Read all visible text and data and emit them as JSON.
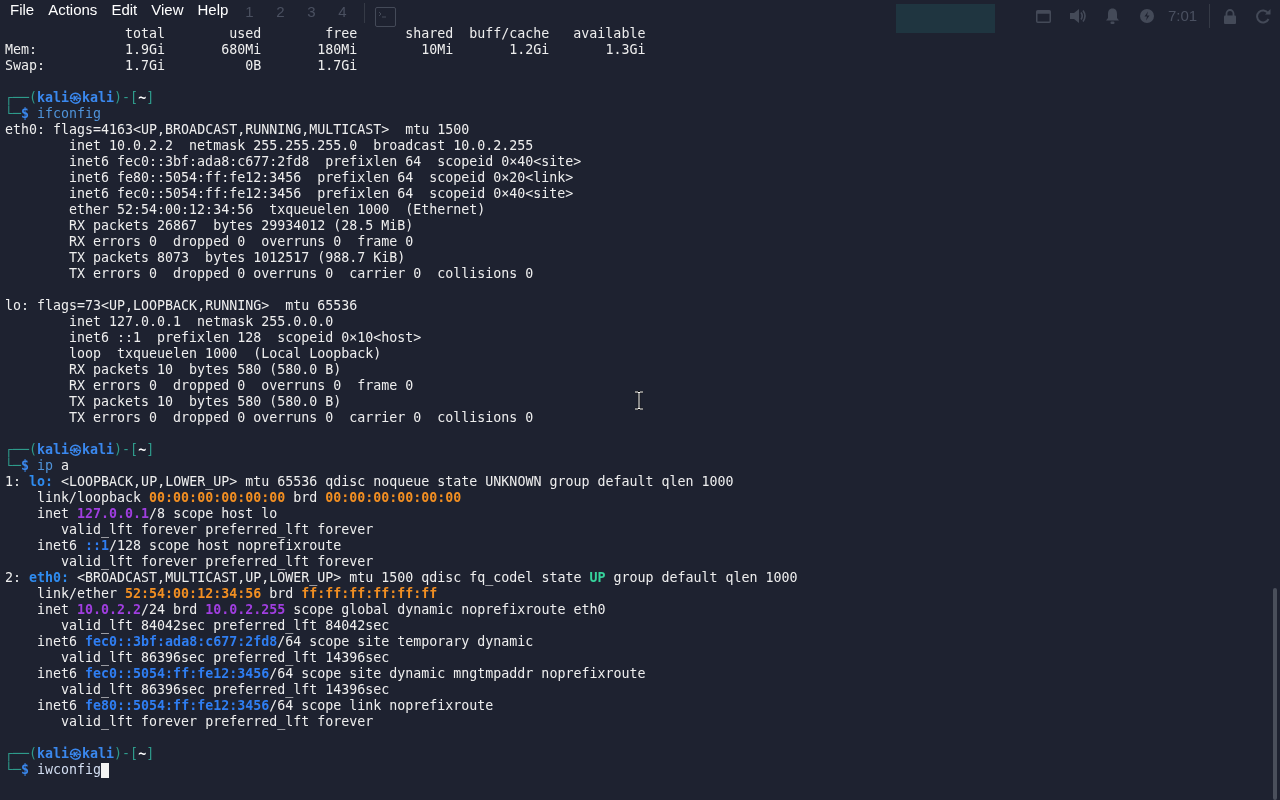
{
  "menu_bar": {
    "items": [
      "File",
      "Actions",
      "Edit",
      "View",
      "Help"
    ]
  },
  "panel": {
    "workspaces": [
      "1",
      "2",
      "3",
      "4"
    ],
    "clock": "7:01"
  },
  "terminal": {
    "memory_table": {
      "columns": [
        "total",
        "used",
        "free",
        "shared",
        "buff/cache",
        "available"
      ],
      "rows": [
        {
          "label": "Mem:",
          "values": [
            "1.9Gi",
            "680Mi",
            "180Mi",
            "10Mi",
            "1.2Gi",
            "1.3Gi"
          ]
        },
        {
          "label": "Swap:",
          "values": [
            "1.7Gi",
            "0B",
            "1.7Gi"
          ]
        }
      ]
    },
    "sessions": [
      {
        "prompt": {
          "frame_open": "┌──(",
          "user": "kali",
          "at": "㉿",
          "host": "kali",
          "frame_mid": ")-[",
          "dir": "~",
          "frame_close": "]",
          "frame_bottom": "└─",
          "symbol": "$"
        },
        "command": [
          {
            "text": "ifconfig",
            "kind": "command"
          }
        ],
        "cursor": false,
        "output": {
          "kind": "ifconfig",
          "interfaces": [
            {
              "header": "eth0: flags=4163<UP,BROADCAST,RUNNING,MULTICAST>  mtu 1500",
              "lines": [
                "inet 10.0.2.2  netmask 255.255.255.0  broadcast 10.0.2.255",
                "inet6 fec0::3bf:ada8:c677:2fd8  prefixlen 64  scopeid 0×40<site>",
                "inet6 fe80::5054:ff:fe12:3456  prefixlen 64  scopeid 0×20<link>",
                "inet6 fec0::5054:ff:fe12:3456  prefixlen 64  scopeid 0×40<site>",
                "ether 52:54:00:12:34:56  txqueuelen 1000  (Ethernet)",
                "RX packets 26867  bytes 29934012 (28.5 MiB)",
                "RX errors 0  dropped 0  overruns 0  frame 0",
                "TX packets 8073  bytes 1012517 (988.7 KiB)",
                "TX errors 0  dropped 0 overruns 0  carrier 0  collisions 0"
              ]
            },
            {
              "header": "lo: flags=73<UP,LOOPBACK,RUNNING>  mtu 65536",
              "lines": [
                "inet 127.0.0.1  netmask 255.0.0.0",
                "inet6 ::1  prefixlen 128  scopeid 0×10<host>",
                "loop  txqueuelen 1000  (Local Loopback)",
                "RX packets 10  bytes 580 (580.0 B)",
                "RX errors 0  dropped 0  overruns 0  frame 0",
                "TX packets 10  bytes 580 (580.0 B)",
                "TX errors 0  dropped 0 overruns 0  carrier 0  collisions 0"
              ]
            }
          ]
        }
      },
      {
        "prompt": {
          "frame_open": "┌──(",
          "user": "kali",
          "at": "㉿",
          "host": "kali",
          "frame_mid": ")-[",
          "dir": "~",
          "frame_close": "]",
          "frame_bottom": "└─",
          "symbol": "$"
        },
        "command": [
          {
            "text": "ip",
            "kind": "command"
          },
          {
            "text": "a",
            "kind": "argument"
          }
        ],
        "cursor": false,
        "output": {
          "kind": "ip_addr",
          "links": [
            {
              "parts": [
                {
                  "text": "1: ",
                  "kind": "plain"
                },
                {
                  "text": "lo:",
                  "kind": "iface"
                },
                {
                  "text": " <LOOPBACK,UP,LOWER_UP> mtu 65536 qdisc noqueue state UNKNOWN group default qlen 1000",
                  "kind": "plain"
                }
              ],
              "children": [
                {
                  "parts": [
                    {
                      "text": "link/loopback ",
                      "kind": "plain"
                    },
                    {
                      "text": "00:00:00:00:00:00",
                      "kind": "mac"
                    },
                    {
                      "text": " brd ",
                      "kind": "plain"
                    },
                    {
                      "text": "00:00:00:00:00:00",
                      "kind": "mac"
                    }
                  ]
                },
                {
                  "parts": [
                    {
                      "text": "inet ",
                      "kind": "plain"
                    },
                    {
                      "text": "127.0.0.1",
                      "kind": "ipv4"
                    },
                    {
                      "text": "/8 scope host lo",
                      "kind": "plain"
                    }
                  ],
                  "children": [
                    {
                      "parts": [
                        {
                          "text": "valid_lft forever preferred_lft forever",
                          "kind": "plain"
                        }
                      ]
                    }
                  ]
                },
                {
                  "parts": [
                    {
                      "text": "inet6 ",
                      "kind": "plain"
                    },
                    {
                      "text": "::1",
                      "kind": "ipv6"
                    },
                    {
                      "text": "/128 scope host noprefixroute",
                      "kind": "plain"
                    }
                  ],
                  "children": [
                    {
                      "parts": [
                        {
                          "text": "valid_lft forever preferred_lft forever",
                          "kind": "plain"
                        }
                      ]
                    }
                  ]
                }
              ]
            },
            {
              "parts": [
                {
                  "text": "2: ",
                  "kind": "plain"
                },
                {
                  "text": "eth0:",
                  "kind": "iface"
                },
                {
                  "text": " <BROADCAST,MULTICAST,UP,LOWER_UP> mtu 1500 qdisc fq_codel state ",
                  "kind": "plain"
                },
                {
                  "text": "UP",
                  "kind": "state"
                },
                {
                  "text": " group default qlen 1000",
                  "kind": "plain"
                }
              ],
              "children": [
                {
                  "parts": [
                    {
                      "text": "link/ether ",
                      "kind": "plain"
                    },
                    {
                      "text": "52:54:00:12:34:56",
                      "kind": "mac"
                    },
                    {
                      "text": " brd ",
                      "kind": "plain"
                    },
                    {
                      "text": "ff:ff:ff:ff:ff:ff",
                      "kind": "mac"
                    }
                  ]
                },
                {
                  "parts": [
                    {
                      "text": "inet ",
                      "kind": "plain"
                    },
                    {
                      "text": "10.0.2.2",
                      "kind": "ipv4"
                    },
                    {
                      "text": "/24 brd ",
                      "kind": "plain"
                    },
                    {
                      "text": "10.0.2.255",
                      "kind": "ipv4"
                    },
                    {
                      "text": " scope global dynamic noprefixroute eth0",
                      "kind": "plain"
                    }
                  ],
                  "children": [
                    {
                      "parts": [
                        {
                          "text": "valid_lft 84042sec preferred_lft 84042sec",
                          "kind": "plain"
                        }
                      ]
                    }
                  ]
                },
                {
                  "parts": [
                    {
                      "text": "inet6 ",
                      "kind": "plain"
                    },
                    {
                      "text": "fec0::3bf:ada8:c677:2fd8",
                      "kind": "ipv6"
                    },
                    {
                      "text": "/64 scope site temporary dynamic",
                      "kind": "plain"
                    }
                  ],
                  "children": [
                    {
                      "parts": [
                        {
                          "text": "valid_lft 86396sec preferred_lft 14396sec",
                          "kind": "plain"
                        }
                      ]
                    }
                  ]
                },
                {
                  "parts": [
                    {
                      "text": "inet6 ",
                      "kind": "plain"
                    },
                    {
                      "text": "fec0::5054:ff:fe12:3456",
                      "kind": "ipv6"
                    },
                    {
                      "text": "/64 scope site dynamic mngtmpaddr noprefixroute",
                      "kind": "plain"
                    }
                  ],
                  "children": [
                    {
                      "parts": [
                        {
                          "text": "valid_lft 86396sec preferred_lft 14396sec",
                          "kind": "plain"
                        }
                      ]
                    }
                  ]
                },
                {
                  "parts": [
                    {
                      "text": "inet6 ",
                      "kind": "plain"
                    },
                    {
                      "text": "fe80::5054:ff:fe12:3456",
                      "kind": "ipv6"
                    },
                    {
                      "text": "/64 scope link noprefixroute",
                      "kind": "plain"
                    }
                  ],
                  "children": [
                    {
                      "parts": [
                        {
                          "text": "valid_lft forever preferred_lft forever",
                          "kind": "plain"
                        }
                      ]
                    }
                  ]
                }
              ]
            }
          ]
        }
      },
      {
        "prompt": {
          "frame_open": "┌──(",
          "user": "kali",
          "at": "㉿",
          "host": "kali",
          "frame_mid": ")-[",
          "dir": "~",
          "frame_close": "]",
          "frame_bottom": "└─",
          "symbol": "$"
        },
        "command": [
          {
            "text": "iwconfig",
            "kind": "pending"
          }
        ],
        "cursor": true
      }
    ]
  }
}
